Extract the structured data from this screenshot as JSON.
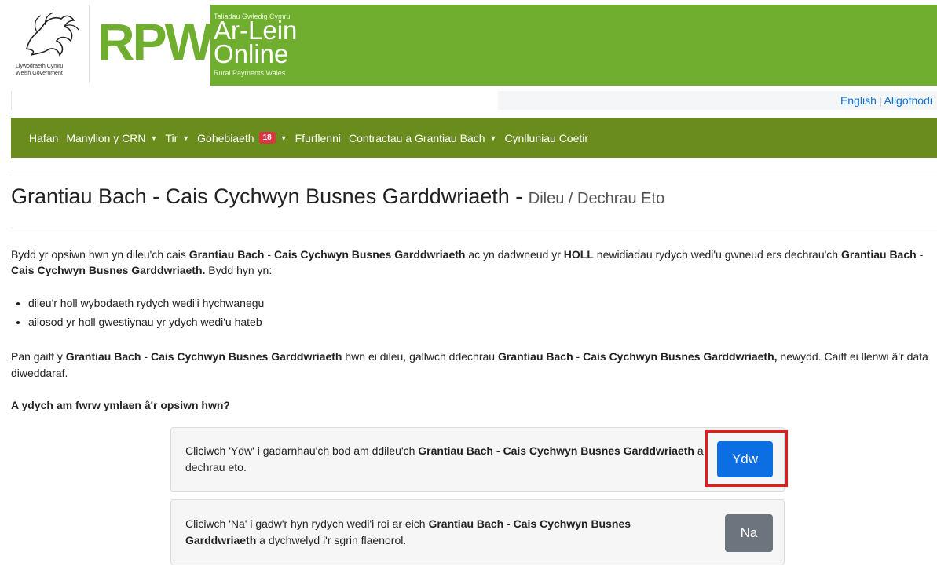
{
  "header": {
    "gov_line1": "Llywodraeth Cymru",
    "gov_line2": "Welsh Government",
    "rpw": "RPW",
    "sub_top": "Taliadau Gwledig Cymru",
    "ar_lein": "Ar-Lein",
    "online": "Online",
    "sub_bottom": "Rural Payments Wales",
    "brand_color": "#6fae2f"
  },
  "lang": {
    "english": "English",
    "separator": "|",
    "logout": "Allgofnodi"
  },
  "nav": {
    "items": [
      {
        "label": "Hafan"
      },
      {
        "label": "Manylion y CRN"
      },
      {
        "label": "Tir"
      },
      {
        "label": "Gohebiaeth",
        "badge": "18"
      },
      {
        "label": "Ffurflenni"
      },
      {
        "label": "Contractau a Grantiau Bach"
      },
      {
        "label": "Cynlluniau Coetir"
      }
    ]
  },
  "page": {
    "title": "Grantiau Bach - Cais Cychwyn Busnes Garddwriaeth - ",
    "subtitle": "Dileu / Dechrau Eto",
    "p1_a": "Bydd yr opsiwn hwn yn dileu'ch cais ",
    "p1_b": "Grantiau Bach",
    "p1_c": " - ",
    "p1_d": "Cais Cychwyn Busnes Garddwriaeth",
    "p1_e": " ac yn dadwneud yr ",
    "p1_f": "HOLL",
    "p1_g": " newidiadau rydych wedi'u gwneud ers dechrau'ch ",
    "p1_h": "Grantiau Bach",
    "p1_i": " - ",
    "p1_j": "Cais Cychwyn Busnes Garddwriaeth.",
    "p1_k": " Bydd hyn yn:",
    "bullets": [
      "dileu'r holl wybodaeth rydych wedi'i hychwanegu",
      "ailosod yr holl gwestiynau yr ydych wedi'u hateb"
    ],
    "p2_a": "Pan gaiff y ",
    "p2_b": "Grantiau Bach",
    "p2_c": " - ",
    "p2_d": "Cais Cychwyn Busnes Garddwriaeth",
    "p2_e": " hwn ei dileu, gallwch ddechrau ",
    "p2_f": "Grantiau Bach",
    "p2_g": " - ",
    "p2_h": "Cais Cychwyn Busnes Garddwriaeth,",
    "p2_i": " newydd. Caiff ei llenwi â'r data diweddaraf.",
    "question": "A ydych am fwrw ymlaen â'r opsiwn hwn?"
  },
  "card_yes": {
    "t1": "Cliciwch 'Ydw' i gadarnhau'ch bod am ddileu'ch ",
    "t2": "Grantiau Bach",
    "t3": " - ",
    "t4": "Cais Cychwyn Busnes Garddwriaeth",
    "t5": " a dechrau eto.",
    "button": "Ydw"
  },
  "card_no": {
    "t1": "Cliciwch 'Na' i gadw'r hyn rydych wedi'i roi ar eich ",
    "t2": "Grantiau Bach",
    "t3": " - ",
    "t4": "Cais Cychwyn Busnes Garddwriaeth",
    "t5": " a dychwelyd i'r sgrin flaenorol.",
    "button": "Na"
  }
}
